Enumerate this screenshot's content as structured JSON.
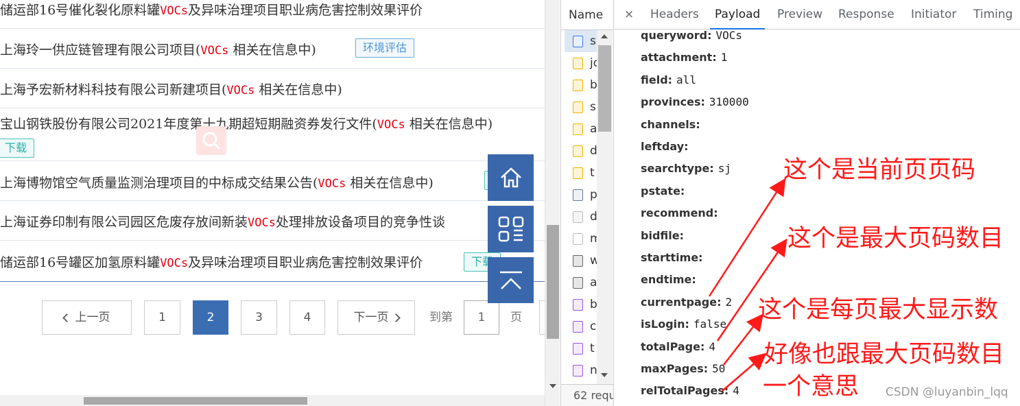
{
  "search_results": [
    {
      "before": "储运部16号催化裂化原料罐",
      "keyword": "VOCs",
      "after": "及异味治理项目职业病危害控制效果评价",
      "tag": ""
    },
    {
      "before": "上海玲一供应链管理有限公司项目(",
      "keyword": "VOCs",
      "after": " 相关在信息中)",
      "tag": "环境评估"
    },
    {
      "before": "上海予宏新材料科技有限公司新建项目(",
      "keyword": "VOCs",
      "after": " 相关在信息中)",
      "tag": ""
    },
    {
      "before": "宝山钢铁股份有限公司2021年度第十九期超短期融资券发行文件(",
      "keyword": "VOCs",
      "after": " 相关在信息中)",
      "tag": "下载"
    },
    {
      "before": "上海博物馆空气质量监测治理项目的中标成交结果公告(",
      "keyword": "VOCs",
      "after": " 相关在信息中)",
      "tag": ""
    },
    {
      "before": "上海证券印制有限公司园区危废存放间新装",
      "keyword": "VOCs",
      "after": "处理排放设备项目的竞争性谈",
      "tag": ""
    },
    {
      "before": "储运部16号罐区加氢原料罐",
      "keyword": "VOCs",
      "after": "及异味治理项目职业病危害控制效果评价",
      "tag": "下载"
    }
  ],
  "pagination": {
    "prev": "上一页",
    "pages": [
      "1",
      "2",
      "3",
      "4"
    ],
    "current": "2",
    "next": "下一页",
    "goto_label": "到第",
    "goto_value": "1",
    "page_unit": "页"
  },
  "devtools": {
    "name_header": "Name",
    "requests": [
      {
        "name": "s",
        "type": "doc"
      },
      {
        "name": "jq",
        "type": "js"
      },
      {
        "name": "b",
        "type": "js"
      },
      {
        "name": "s",
        "type": "js"
      },
      {
        "name": "a",
        "type": "js"
      },
      {
        "name": "d",
        "type": "js"
      },
      {
        "name": "t",
        "type": "js"
      },
      {
        "name": "p",
        "type": "fetch"
      },
      {
        "name": "d",
        "type": "img"
      },
      {
        "name": "m",
        "type": "blank"
      },
      {
        "name": "w",
        "type": "font"
      },
      {
        "name": "a",
        "type": "font"
      },
      {
        "name": "b",
        "type": "css"
      },
      {
        "name": "c",
        "type": "css"
      },
      {
        "name": "t",
        "type": "css"
      },
      {
        "name": "n",
        "type": "css"
      }
    ],
    "footer": "62 requ",
    "close_symbol": "×",
    "tabs": [
      "Headers",
      "Payload",
      "Preview",
      "Response",
      "Initiator",
      "Timing"
    ],
    "active_tab": "Payload",
    "payload": [
      {
        "key": "queryword:",
        "value": "VOCs"
      },
      {
        "key": "attachment:",
        "value": "1"
      },
      {
        "key": "field:",
        "value": "all"
      },
      {
        "key": "provinces:",
        "value": "310000"
      },
      {
        "key": "channels:",
        "value": ""
      },
      {
        "key": "leftday:",
        "value": ""
      },
      {
        "key": "searchtype:",
        "value": "sj"
      },
      {
        "key": "pstate:",
        "value": ""
      },
      {
        "key": "recommend:",
        "value": ""
      },
      {
        "key": "bidfile:",
        "value": ""
      },
      {
        "key": "starttime:",
        "value": ""
      },
      {
        "key": "endtime:",
        "value": ""
      },
      {
        "key": "currentpage:",
        "value": "2"
      },
      {
        "key": "isLogin:",
        "value": "false"
      },
      {
        "key": "totalPage:",
        "value": "4"
      },
      {
        "key": "maxPages:",
        "value": "50"
      },
      {
        "key": "relTotalPages:",
        "value": "4"
      }
    ]
  },
  "annotations": [
    "这个是当前页页码",
    "这个是最大页码数目",
    "这个是每页最大显示数",
    "好像也跟最大页码数目",
    "一个意思"
  ],
  "watermark": "CSDN @luyanbin_lqq",
  "colors": {
    "keyword": "#e60012",
    "pager_active": "#3b6db3",
    "side_button": "#3a67ab",
    "annotation": "#ff1a1a",
    "tab_underline": "#1a73e8"
  },
  "icons": [
    "search-icon",
    "home-icon",
    "qrcode-icon",
    "back-to-top-icon",
    "chevron-left-icon",
    "chevron-right-icon"
  ]
}
